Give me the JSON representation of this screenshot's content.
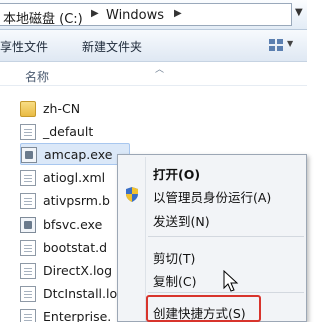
{
  "address": {
    "crumbs": [
      "本地磁盘 (C:)",
      "Windows"
    ]
  },
  "toolbar": {
    "share_label": "享性文件",
    "new_folder_label": "新建文件夹"
  },
  "columns": {
    "name_label": "名称"
  },
  "files": [
    {
      "name": "zh-CN",
      "type": "folder"
    },
    {
      "name": "_default",
      "type": "shortcut"
    },
    {
      "name": "amcap.exe",
      "type": "exe",
      "selected": true
    },
    {
      "name": "atiogl.xml",
      "type": "doc"
    },
    {
      "name": "ativpsrm.b",
      "type": "doc"
    },
    {
      "name": "bfsvc.exe",
      "type": "exe"
    },
    {
      "name": "bootstat.d",
      "type": "doc"
    },
    {
      "name": "DirectX.log",
      "type": "doc"
    },
    {
      "name": "DtcInstall.lo",
      "type": "doc"
    },
    {
      "name": "Enterprise.",
      "type": "doc"
    }
  ],
  "context_menu": {
    "open": "打开(O)",
    "run_as_admin": "以管理员身份运行(A)",
    "send_to": "发送到(N)",
    "cut": "剪切(T)",
    "copy": "复制(C)",
    "create_shortcut": "创建快捷方式(S)"
  },
  "colors": {
    "highlight_border": "#d8342c",
    "selection": "#dbe8f8"
  }
}
